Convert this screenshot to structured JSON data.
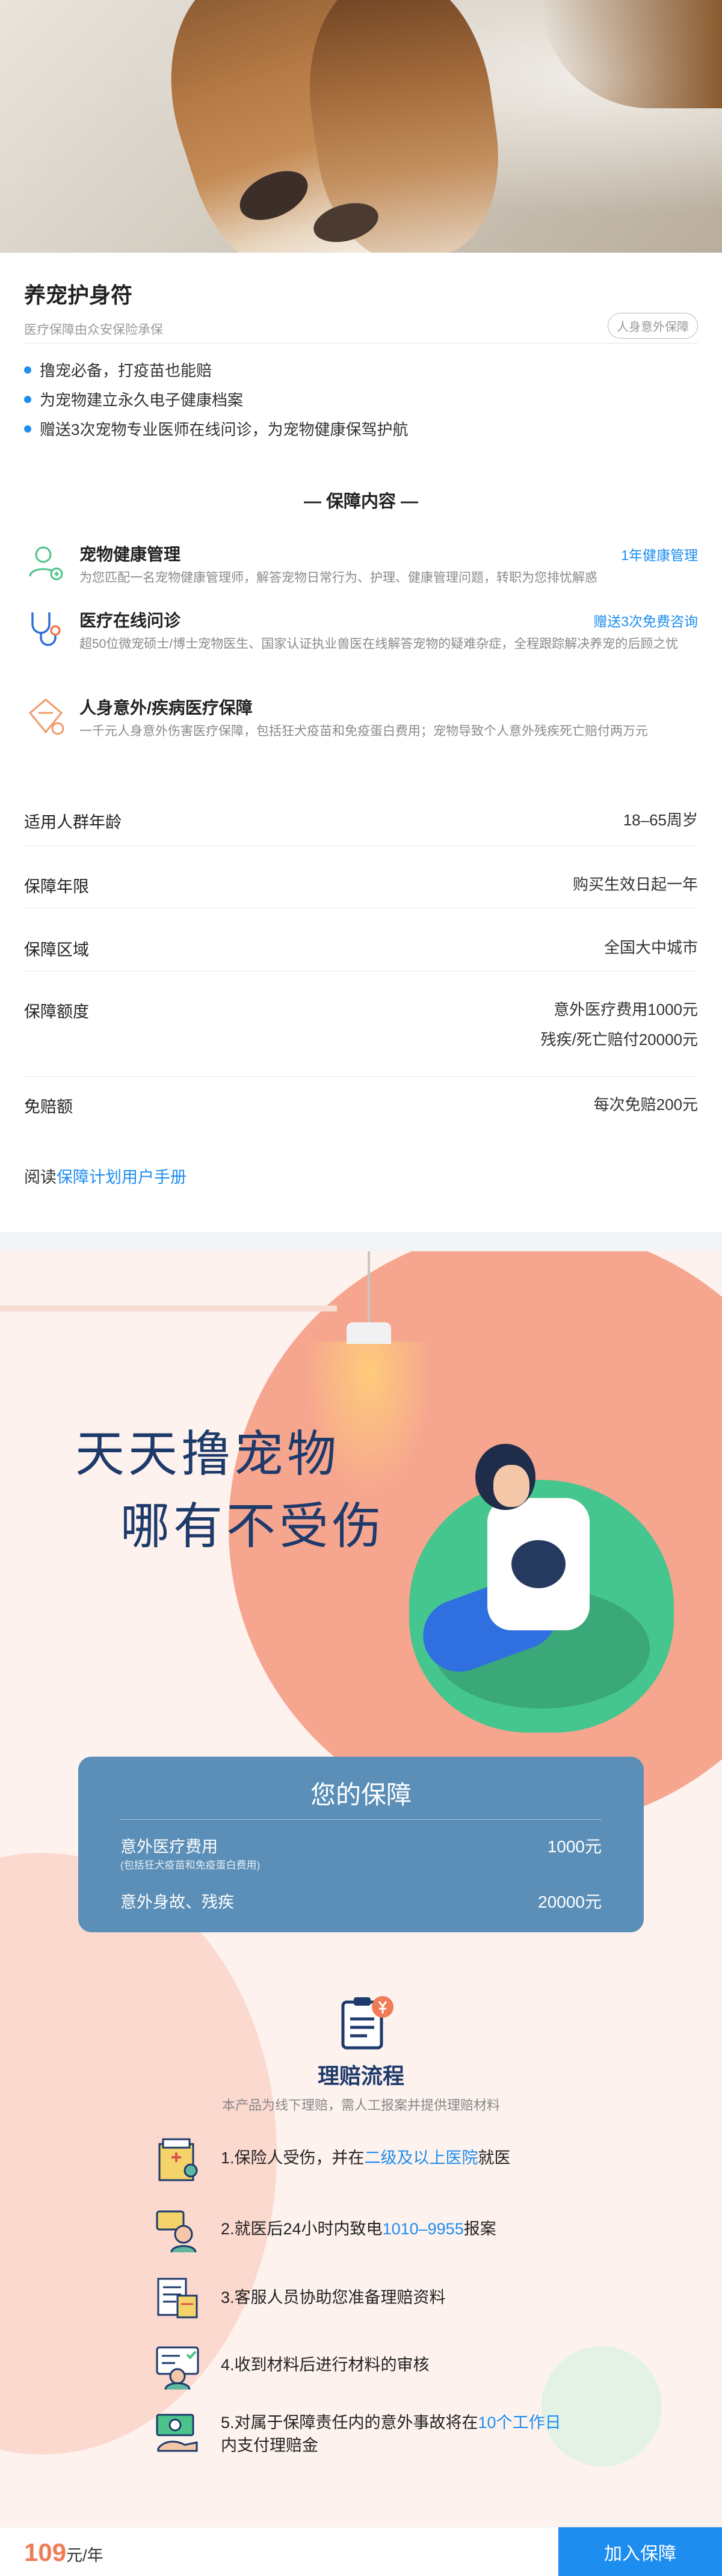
{
  "product": {
    "title": "养宠护身符",
    "subtitle": "医疗保障由众安保险承保",
    "tag": "人身意外保障",
    "highlights": [
      "撸宠必备，打疫苗也能赔",
      "为宠物建立永久电子健康档案",
      "赠送3次宠物专业医师在线问诊，为宠物健康保驾护航"
    ]
  },
  "coverage": {
    "heading": "— 保障内容 —",
    "items": [
      {
        "name": "宠物健康管理",
        "tag": "1年健康管理",
        "desc": "为您匹配一名宠物健康管理师，解答宠物日常行为、护理、健康管理问题，转职为您排忧解惑",
        "icon": "person-health-icon"
      },
      {
        "name": "医疗在线问诊",
        "tag": "赠送3次免费咨询",
        "desc": "超50位微宠硕士/博士宠物医生、国家认证执业兽医在线解答宠物的疑难杂症，全程跟踪解决养宠的后顾之忧",
        "icon": "stethoscope-icon"
      },
      {
        "name": "人身意外/疾病医疗保障",
        "tag": "",
        "desc": "一千元人身意外伤害医疗保障，包括狂犬疫苗和免疫蛋白费用；宠物导致个人意外残疾死亡赔付两万元",
        "icon": "shield-diamond-icon"
      }
    ]
  },
  "info": [
    {
      "key": "适用人群年龄",
      "values": [
        "18–65周岁"
      ]
    },
    {
      "key": "保障年限",
      "values": [
        "购买生效日起一年"
      ]
    },
    {
      "key": "保障区域",
      "values": [
        "全国大中城市"
      ]
    },
    {
      "key": "保障额度",
      "values": [
        "意外医疗费用1000元",
        "残疾/死亡赔付20000元"
      ]
    },
    {
      "key": "免赔额",
      "values": [
        "每次免赔200元"
      ]
    }
  ],
  "read": {
    "prefix": "阅读",
    "link": "保障计划用户手册"
  },
  "illustration": {
    "slogan_line1": "天天撸宠物",
    "slogan_line2": "哪有不受伤"
  },
  "panel": {
    "title": "您的保障",
    "rows": [
      {
        "label": "意外医疗费用",
        "sub": "(包括狂犬疫苗和免疫蛋白费用)",
        "value": "1000元"
      },
      {
        "label": "意外身故、残疾",
        "sub": "",
        "value": "20000元"
      }
    ]
  },
  "claims": {
    "title": "理赔流程",
    "subtitle": "本产品为线下理赔，需人工报案并提供理赔材料",
    "steps": [
      {
        "pre": "1.保险人受伤，并在",
        "hl": "二级及以上医院",
        "post": "就医",
        "icon": "hospital-icon"
      },
      {
        "pre": "2.就医后24小时内致电",
        "hl": "1010–9955",
        "post": "报案",
        "icon": "phone-call-icon"
      },
      {
        "pre": "3.客服人员协助您准备理赔资料",
        "hl": "",
        "post": "",
        "icon": "documents-icon"
      },
      {
        "pre": "4.收到材料后进行材料的审核",
        "hl": "",
        "post": "",
        "icon": "review-icon"
      },
      {
        "pre": "5.对属于保障责任内的意外事故将在",
        "hl": "10个工作日",
        "post": "内支付理赔金",
        "icon": "payment-icon"
      }
    ]
  },
  "bottom": {
    "price": "109",
    "unit": "元/年",
    "cta": "加入保障"
  },
  "colors": {
    "accent": "#1e8df0",
    "price": "#f07b57",
    "panel": "#5b8fb7",
    "navy": "#1d3a6b"
  }
}
